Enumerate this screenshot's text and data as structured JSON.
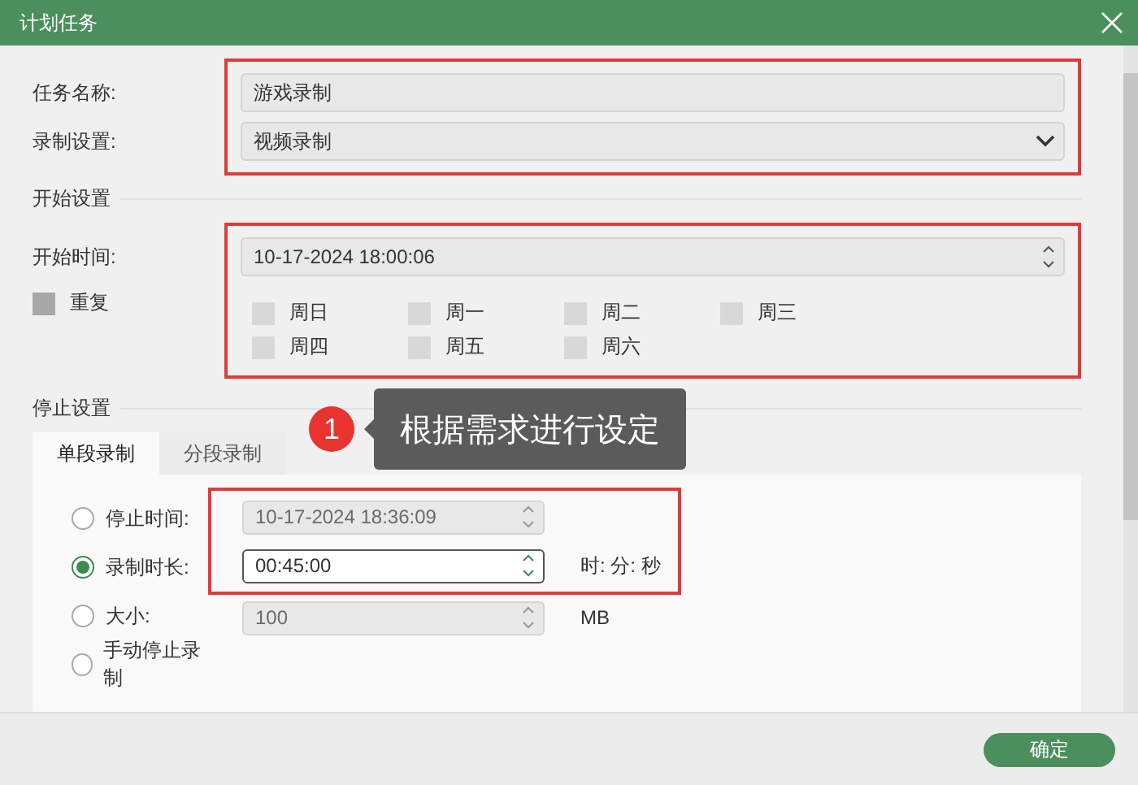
{
  "window": {
    "title": "计划任务"
  },
  "task_name": {
    "label": "任务名称:",
    "value": "游戏录制"
  },
  "record_setting": {
    "label": "录制设置:",
    "value": "视频录制"
  },
  "start_section": {
    "title": "开始设置",
    "start_time": {
      "label": "开始时间:",
      "value": "10-17-2024 18:00:06"
    },
    "repeat": {
      "label": "重复",
      "checked": false
    },
    "weekdays": [
      {
        "label": "周日",
        "checked": false
      },
      {
        "label": "周一",
        "checked": false
      },
      {
        "label": "周二",
        "checked": false
      },
      {
        "label": "周三",
        "checked": false
      },
      {
        "label": "周四",
        "checked": false
      },
      {
        "label": "周五",
        "checked": false
      },
      {
        "label": "周六",
        "checked": false
      }
    ]
  },
  "stop_section": {
    "title": "停止设置",
    "tabs": [
      {
        "label": "单段录制",
        "selected": true
      },
      {
        "label": "分段录制",
        "selected": false
      }
    ],
    "options": [
      {
        "label": "停止时间:",
        "selected": false,
        "value": "10-17-2024 18:36:09"
      },
      {
        "label": "录制时长:",
        "selected": true,
        "value": "00:45:00",
        "unit": "时: 分: 秒"
      },
      {
        "label": "大小:",
        "selected": false,
        "value": "100",
        "unit": "MB"
      },
      {
        "label": "手动停止录制",
        "selected": false
      }
    ]
  },
  "callout": {
    "number": "1",
    "text": "根据需求进行设定"
  },
  "buttons": [
    {
      "label": "确定"
    }
  ]
}
